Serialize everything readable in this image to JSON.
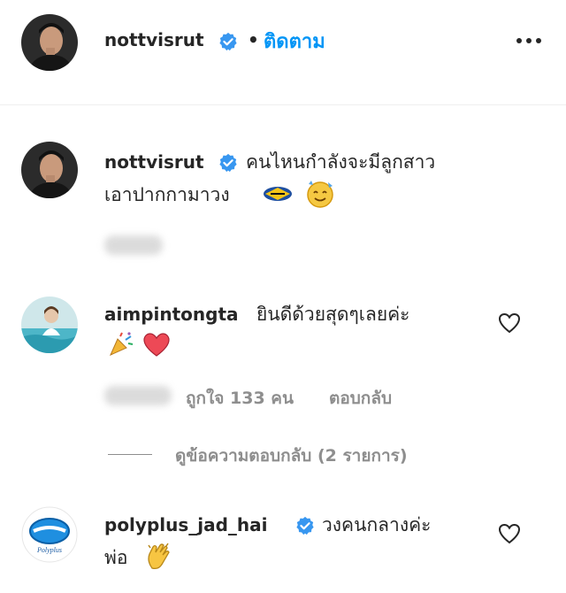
{
  "header": {
    "username": "nottvisrut",
    "separator": "•",
    "follow_label": "ติดตาม"
  },
  "caption": {
    "username": "nottvisrut",
    "text_line1": "คนไหนกำลังจะมีลูกสาว",
    "text_line2": "เอาปากกามาวง"
  },
  "comments": [
    {
      "username": "aimpintongta",
      "text_line1": "ยินดีด้วยสุดๆเลยค่ะ",
      "likes_label": "ถูกใจ 133 คน",
      "reply_label": "ตอบกลับ",
      "view_replies_label": "ดูข้อความตอบกลับ (2 รายการ)"
    },
    {
      "username": "polyplus_jad_hai",
      "text_line1": "วงคนกลางค่ะ",
      "text_line2": "พ่อ",
      "avatar_text": "Polyplus"
    }
  ],
  "colors": {
    "link_blue": "#0095f6",
    "verified_blue": "#3897f0",
    "muted": "#8e8e8e",
    "heart_red": "#ed4956"
  },
  "icons": [
    "verified-badge-icon",
    "more-options-icon",
    "heart-outline-icon",
    "party-popper-icon",
    "red-heart-icon",
    "pen-icon",
    "sparkle-face-icon",
    "clapping-hands-icon"
  ]
}
